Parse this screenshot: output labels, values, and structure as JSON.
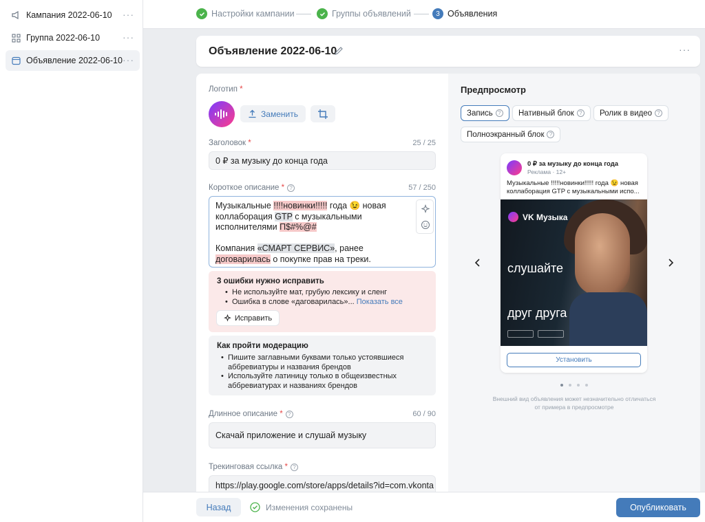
{
  "sidebar": {
    "items": [
      {
        "label": "Кампания 2022-06-10",
        "icon": "megaphone-icon"
      },
      {
        "label": "Группа 2022-06-10",
        "icon": "grid-icon"
      },
      {
        "label": "Объявление 2022-06-10",
        "icon": "ad-icon",
        "active": true
      }
    ],
    "more_label": "···"
  },
  "stepper": {
    "steps": [
      {
        "label": "Настройки кампании",
        "state": "done"
      },
      {
        "label": "Группы объявлений",
        "state": "done"
      },
      {
        "label": "Объявления",
        "state": "current",
        "number": "3"
      }
    ]
  },
  "header": {
    "title": "Объявление 2022-06-10",
    "more_label": "···"
  },
  "form": {
    "logo": {
      "label": "Логотип",
      "required_mark": "*",
      "replace_label": "Заменить"
    },
    "headline": {
      "label": "Заголовок",
      "required_mark": "*",
      "counter": "25 / 25",
      "value": "0 ₽ за музыку до конца года"
    },
    "short_desc": {
      "label": "Короткое описание",
      "required_mark": "*",
      "help": "?",
      "counter": "57 / 250",
      "p1_a": "Музыкальные ",
      "p1_hl1": "!!!!новинки!!!!!",
      "p1_b": " года 😉 новая коллаборация ",
      "p1_hl2": "GTP",
      "p1_c": " с музыкальными исполнителями ",
      "p1_hl3": "П$#%@#",
      "p2_a": "Компания ",
      "p2_hl1": "«СМАРТ СЕРВИС»",
      "p2_b": ", ранее ",
      "p2_hl2": "договарилась",
      "p2_c": " о покупке прав на треки."
    },
    "errors": {
      "title": "3 ошибки нужно исправить",
      "item1": "Не используйте мат, грубую лексику и сленг",
      "item2": "Ошибка в слове «даговарилась»...",
      "show_all": "Показать все",
      "fix_label": "Исправить"
    },
    "moderation": {
      "title": "Как пройти модерацию",
      "item1_l1": "Пишите заглавными буквами только устоявшиеся",
      "item1_l2": "аббревиатуры и названия брендов",
      "item2_l1": "Используйте латиницу только в общеизвестных",
      "item2_l2": "аббревиатурах и названиях брендов"
    },
    "long_desc": {
      "label": "Длинное описание",
      "required_mark": "*",
      "help": "?",
      "counter": "60 / 90",
      "value": "Скачай приложение и слушай музыку"
    },
    "tracking": {
      "label": "Трекинговая ссылка",
      "required_mark": "*",
      "help": "?",
      "value": "https://play.google.com/store/apps/details?id=com.vkonta"
    }
  },
  "preview": {
    "title": "Предпросмотр",
    "chips": [
      {
        "label": "Запись",
        "active": true
      },
      {
        "label": "Нативный блок"
      },
      {
        "label": "Ролик в видео"
      },
      {
        "label": "Полноэкранный блок"
      }
    ],
    "help": "?",
    "ad": {
      "title": "0 ₽ за музыку до конца года",
      "sub": "Реклама · 12+",
      "text": "Музыкальные !!!!!новинки!!!!! года 😉 новая коллаборация GTP с музыкальными испо...",
      "brand": "VK Музыка",
      "line1": "слушайте",
      "line2": "друг друга",
      "cta": "Установить"
    },
    "note": "Внешний вид объявления может незначительно отличаться от примера в предпросмотре"
  },
  "bottom": {
    "back_label": "Назад",
    "saved_label": "Изменения сохранены",
    "publish_label": "Опубликовать"
  },
  "colors": {
    "accent": "#447bba",
    "success": "#4bb34b",
    "error_bg": "#fbe9e9",
    "highlight_red": "#f6c9c9"
  }
}
